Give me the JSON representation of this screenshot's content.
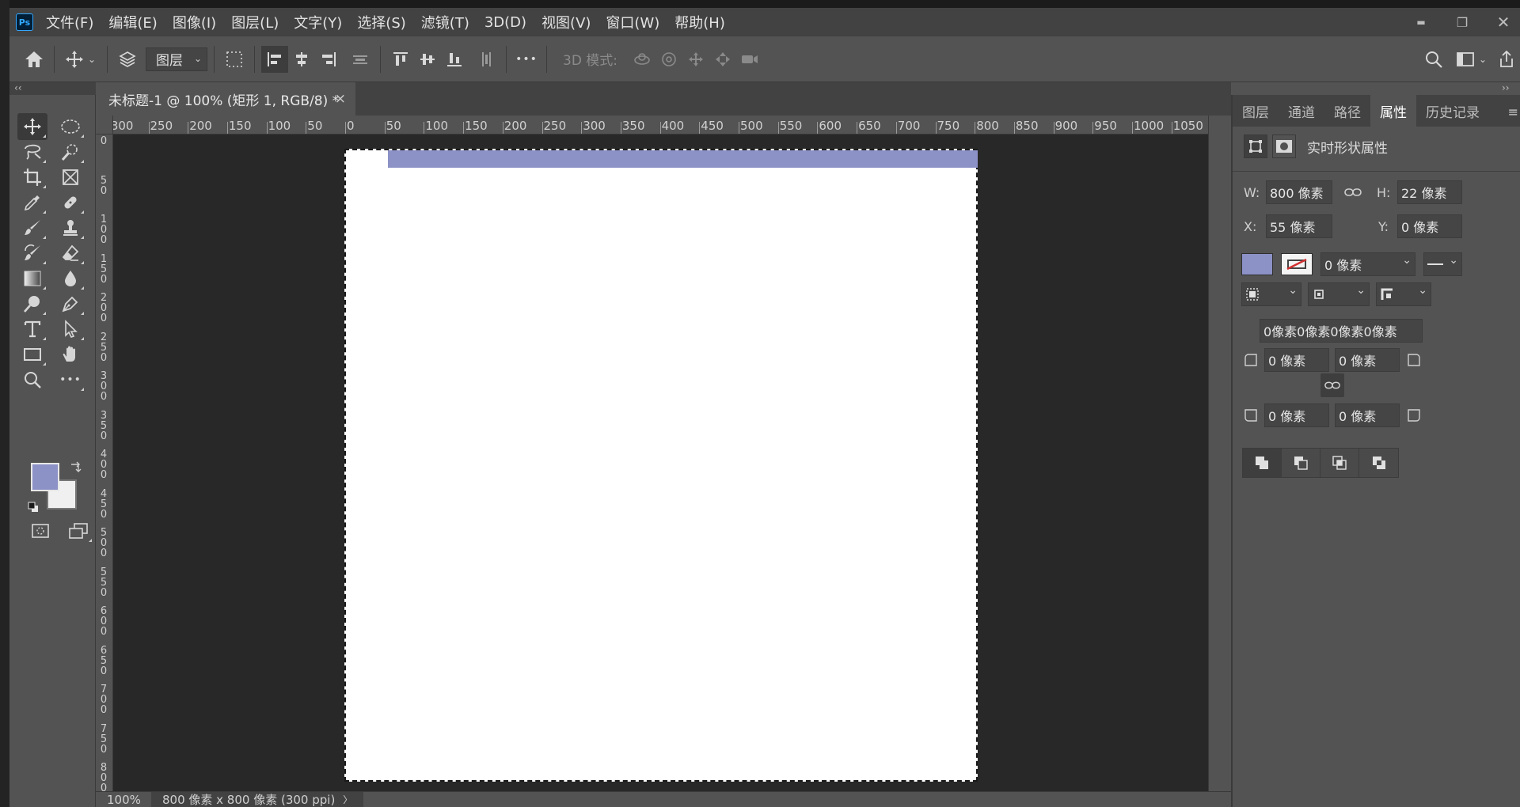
{
  "app": {
    "logo": "Ps"
  },
  "menu": [
    "文件(F)",
    "编辑(E)",
    "图像(I)",
    "图层(L)",
    "文字(Y)",
    "选择(S)",
    "滤镜(T)",
    "3D(D)",
    "视图(V)",
    "窗口(W)",
    "帮助(H)"
  ],
  "window_controls": {
    "minimize": "▬",
    "restore": "❐",
    "close": "✕"
  },
  "options": {
    "auto_select_value": "图层",
    "mode_3d_label": "3D 模式:",
    "more": "•••"
  },
  "collapse": {
    "left": "‹‹",
    "right": "››"
  },
  "document": {
    "tab_title": "未标题-1 @ 100% (矩形 1, RGB/8) *",
    "close": "×"
  },
  "ruler": {
    "top_labels": [
      "300",
      "250",
      "200",
      "150",
      "100",
      "50",
      "0",
      "50",
      "100",
      "150",
      "200",
      "250",
      "300",
      "350",
      "400",
      "450",
      "500",
      "550",
      "600",
      "650",
      "700",
      "750",
      "800",
      "850",
      "900",
      "950",
      "1000",
      "1050"
    ],
    "left_labels": [
      "0",
      "50",
      "100",
      "150",
      "200",
      "250",
      "300",
      "350",
      "400",
      "450",
      "500",
      "550",
      "600",
      "650",
      "700",
      "750",
      "800"
    ]
  },
  "status": {
    "zoom": "100%",
    "doc_info": "800 像素 x 800 像素 (300 ppi)",
    "arrow": "〉"
  },
  "colors": {
    "foreground": "#8c91c6",
    "background": "#f0f0f0",
    "shape_fill": "#8c91c6"
  },
  "panel": {
    "tabs": [
      "图层",
      "通道",
      "路径",
      "属性",
      "历史记录"
    ],
    "active_tab": "属性",
    "menu_icon": "≡",
    "properties_title": "实时形状属性",
    "w_label": "W:",
    "w_value": "800 像素",
    "h_label": "H:",
    "h_value": "22 像素",
    "x_label": "X:",
    "x_value": "55 像素",
    "y_label": "Y:",
    "y_value": "0 像素",
    "stroke_width": "0 像素",
    "radius_combined": "0像素0像素0像素0像素",
    "radius_tl": "0 像素",
    "radius_tr": "0 像素",
    "radius_bl": "0 像素",
    "radius_br": "0 像素"
  }
}
